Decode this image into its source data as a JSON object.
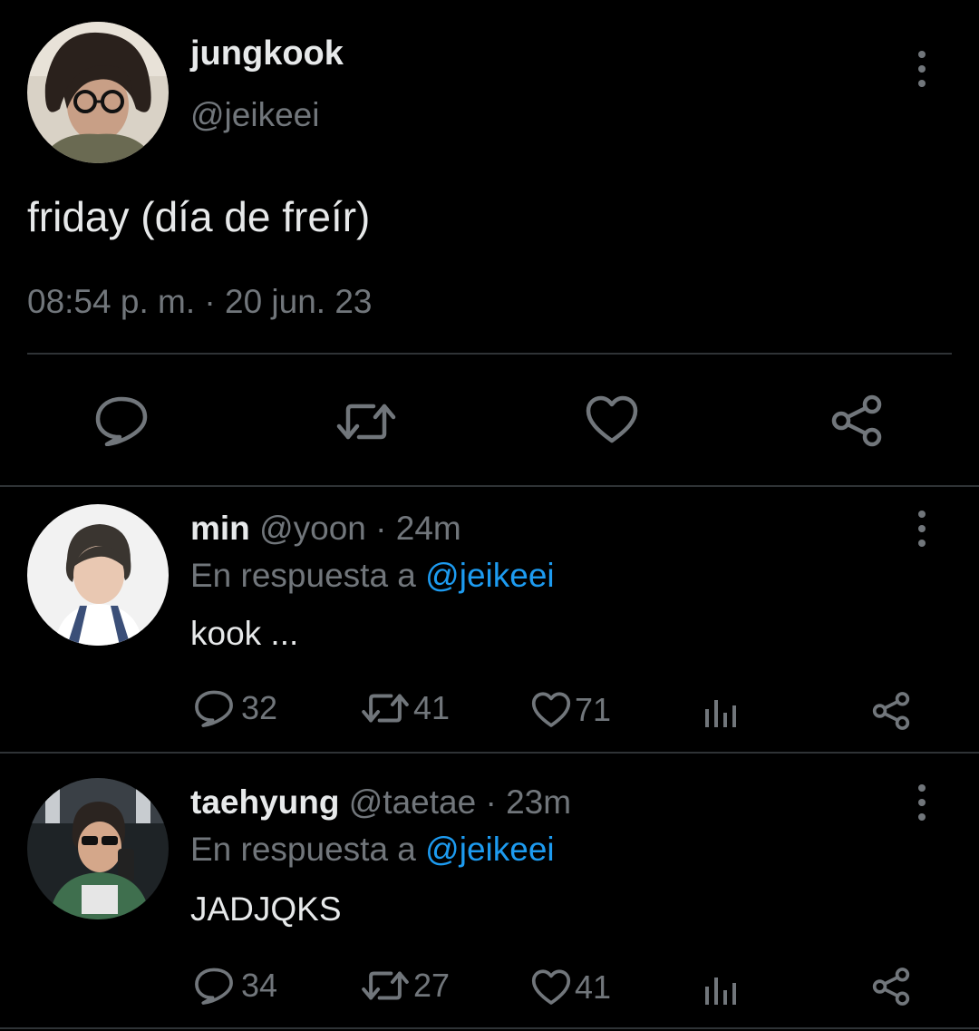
{
  "main_tweet": {
    "author_name": "jungkook",
    "author_handle": "@jeikeei",
    "text": "friday (día de freír)",
    "timestamp": "08:54 p. m. · 20 jun. 23",
    "avatar_icon": "avatar-photo",
    "actions": [
      {
        "icon": "reply-icon"
      },
      {
        "icon": "retweet-icon"
      },
      {
        "icon": "like-icon"
      },
      {
        "icon": "share-icon"
      }
    ]
  },
  "replies": [
    {
      "author_name": "min",
      "author_handle": "@yoon",
      "time": "· 24m",
      "reply_prefix": "En respuesta a",
      "reply_to": "@jeikeei",
      "text": "kook ...",
      "replies_count": "32",
      "retweets_count": "41",
      "likes_count": "71"
    },
    {
      "author_name": "taehyung",
      "author_handle": "@taetae",
      "time": "· 23m",
      "reply_prefix": "En respuesta a",
      "reply_to": "@jeikeei",
      "text": "JADJQKS",
      "replies_count": "34",
      "retweets_count": "27",
      "likes_count": "41"
    }
  ],
  "colors": {
    "background": "#000000",
    "text": "#e7e9ea",
    "muted": "#71767b",
    "accent": "#1d9bf0",
    "divider": "#2f3336"
  }
}
